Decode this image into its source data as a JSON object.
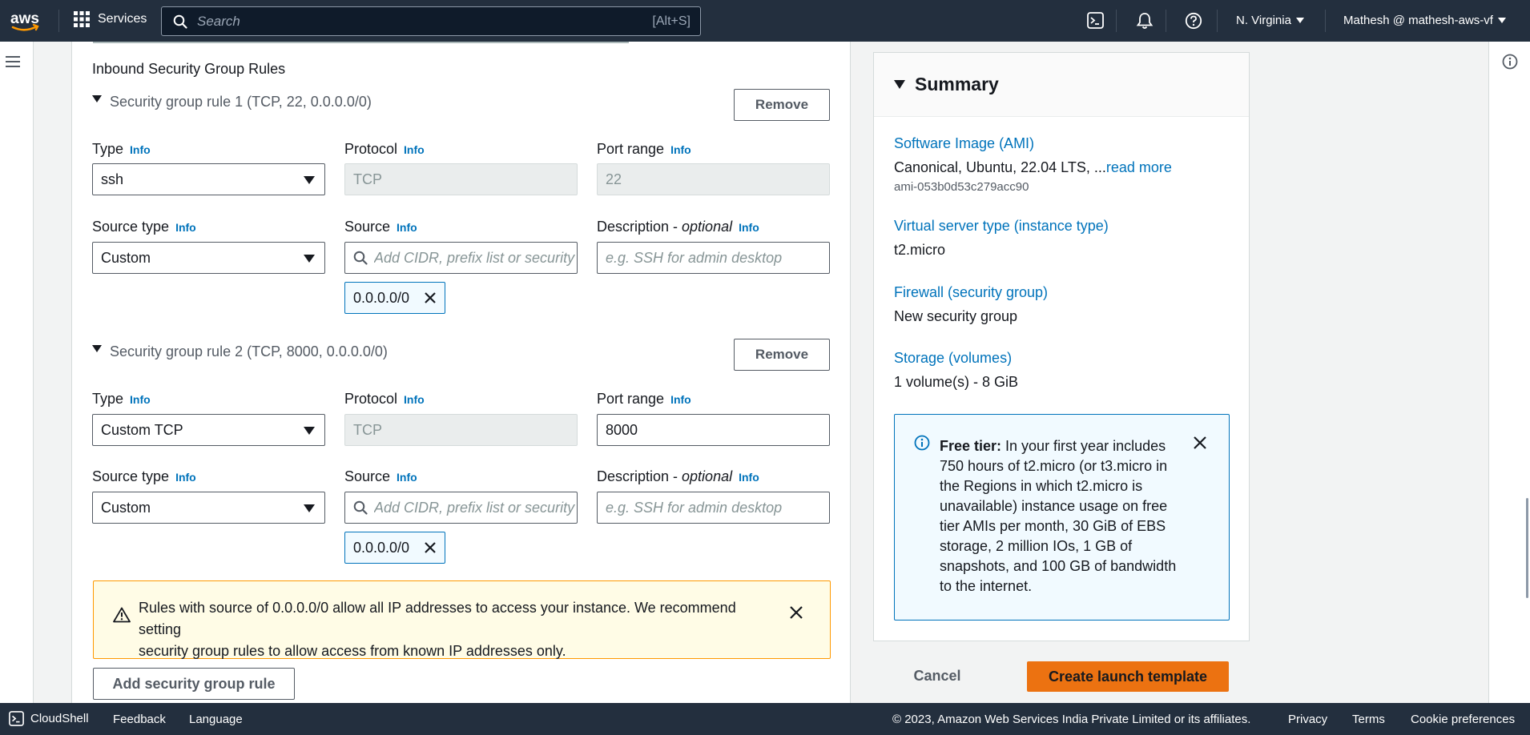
{
  "topbar": {
    "logo_text": "aws",
    "services_label": "Services",
    "search_placeholder": "Search",
    "search_shortcut": "[Alt+S]",
    "region": "N. Virginia",
    "account": "Mathesh @ mathesh-aws-vf"
  },
  "inbound": {
    "section_title": "Inbound Security Group Rules",
    "remove_label": "Remove",
    "info_label": "Info",
    "labels": {
      "type": "Type",
      "protocol": "Protocol",
      "port_range": "Port range",
      "source_type": "Source type",
      "source": "Source",
      "description": "Description - ",
      "optional": "optional"
    },
    "source_placeholder": "Add CIDR, prefix list or security",
    "description_placeholder": "e.g. SSH for admin desktop",
    "rules": [
      {
        "title": "Security group rule 1 (TCP, 22, 0.0.0.0/0)",
        "type": "ssh",
        "protocol": "TCP",
        "port_range": "22",
        "source_type": "Custom",
        "source_token": "0.0.0.0/0"
      },
      {
        "title": "Security group rule 2 (TCP, 8000, 0.0.0.0/0)",
        "type": "Custom TCP",
        "protocol": "TCP",
        "port_range": "8000",
        "source_type": "Custom",
        "source_token": "0.0.0.0/0"
      }
    ],
    "warning": {
      "line1": "Rules with source of 0.0.0.0/0 allow all IP addresses to access your instance. We recommend setting",
      "line2": "security group rules to allow access from known IP addresses only."
    },
    "add_rule_label": "Add security group rule"
  },
  "summary": {
    "title": "Summary",
    "ami_label": "Software Image (AMI)",
    "ami_value": "Canonical, Ubuntu, 22.04 LTS, ...",
    "ami_read_more": "read more",
    "ami_id": "ami-053b0d53c279acc90",
    "instance_type_label": "Virtual server type (instance type)",
    "instance_type_value": "t2.micro",
    "firewall_label": "Firewall (security group)",
    "firewall_value": "New security group",
    "storage_label": "Storage (volumes)",
    "storage_value": "1 volume(s) - 8 GiB",
    "free_tier": {
      "bold": "Free tier:",
      "lines": [
        " In your first year includes",
        "750 hours of t2.micro (or t3.micro in",
        "the Regions in which t2.micro is",
        "unavailable) instance usage on free",
        "tier AMIs per month, 30 GiB of EBS",
        "storage, 2 million IOs, 1 GB of",
        "snapshots, and 100 GB of bandwidth",
        "to the internet."
      ]
    },
    "cancel_label": "Cancel",
    "create_label": "Create launch template"
  },
  "footer": {
    "cloudshell": "CloudShell",
    "feedback": "Feedback",
    "language": "Language",
    "copyright": "© 2023, Amazon Web Services India Private Limited or its affiliates.",
    "privacy": "Privacy",
    "terms": "Terms",
    "cookie": "Cookie preferences"
  },
  "colors": {
    "nav_bg": "#232f3e",
    "link": "#0073bb",
    "primary_button": "#ec7211",
    "warning_border": "#ff9900",
    "info_bg": "#f1faff"
  }
}
